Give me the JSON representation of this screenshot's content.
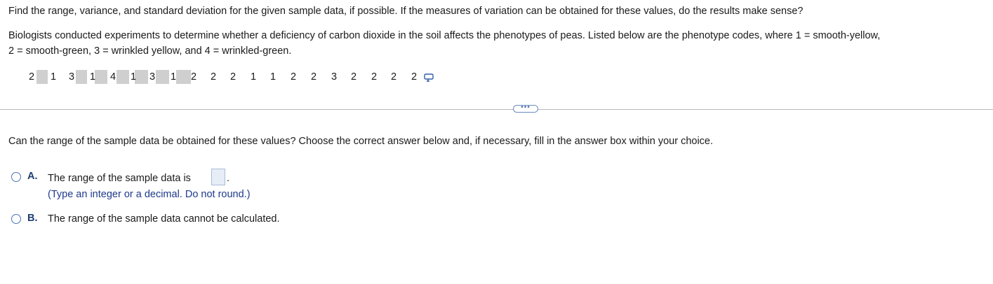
{
  "question": "Find the range, variance, and standard deviation for the given sample data, if possible. If the measures of variation can be obtained for these values, do the results make sense?",
  "context_line1": "Biologists conducted experiments to determine whether a deficiency of carbon dioxide in the soil affects the phenotypes of peas. Listed below are the phenotype codes, where 1 = smooth-yellow,",
  "context_line2": "2 = smooth-green, 3 = wrinkled yellow, and 4 = wrinkled-green.",
  "data_values": [
    "2",
    "1",
    "3",
    "1",
    "4",
    "1",
    "3",
    "1",
    "2",
    "2",
    "2",
    "1",
    "1",
    "2",
    "2",
    "3",
    "2",
    "2",
    "2",
    "2"
  ],
  "prompt": "Can the range of the sample data be obtained for these values? Choose the correct answer below and, if necessary, fill in the answer box within your choice.",
  "options": [
    {
      "letter": "A.",
      "text": "The range of the sample data is",
      "suffix": ".",
      "hint": "(Type an integer or a decimal. Do not round.)",
      "answer_value": ""
    },
    {
      "letter": "B.",
      "text": "The range of the sample data cannot be calculated."
    }
  ],
  "expand_button_label": "•••",
  "icons": {
    "copy": "copy-data-icon"
  },
  "colors": {
    "accent": "#1f3d73",
    "hint": "#1e3a8a",
    "radio": "#4a74b9",
    "shade": "#cfcfcf"
  }
}
